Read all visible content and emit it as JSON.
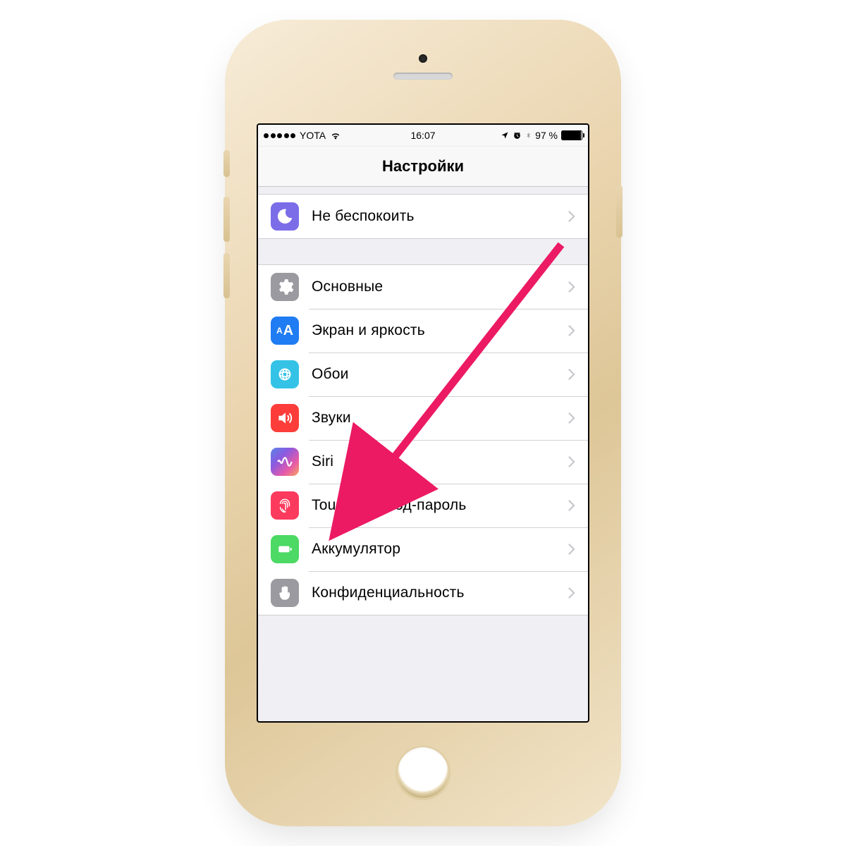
{
  "status": {
    "carrier": "YOTA",
    "time": "16:07",
    "battery_pct": "97 %"
  },
  "nav": {
    "title": "Настройки"
  },
  "group1": {
    "items": [
      {
        "label": "Не беспокоить",
        "icon": "moon-icon"
      }
    ]
  },
  "group2": {
    "items": [
      {
        "label": "Основные",
        "icon": "gear-icon"
      },
      {
        "label": "Экран и яркость",
        "icon": "text-size-icon"
      },
      {
        "label": "Обои",
        "icon": "wallpaper-icon"
      },
      {
        "label": "Звуки",
        "icon": "speaker-icon"
      },
      {
        "label": "Siri",
        "icon": "siri-icon"
      },
      {
        "label": "Touch ID и код-пароль",
        "icon": "fingerprint-icon"
      },
      {
        "label": "Аккумулятор",
        "icon": "battery-icon"
      },
      {
        "label": "Конфиденциальность",
        "icon": "hand-icon"
      }
    ]
  },
  "annotation": {
    "target": "touch-id-row"
  }
}
